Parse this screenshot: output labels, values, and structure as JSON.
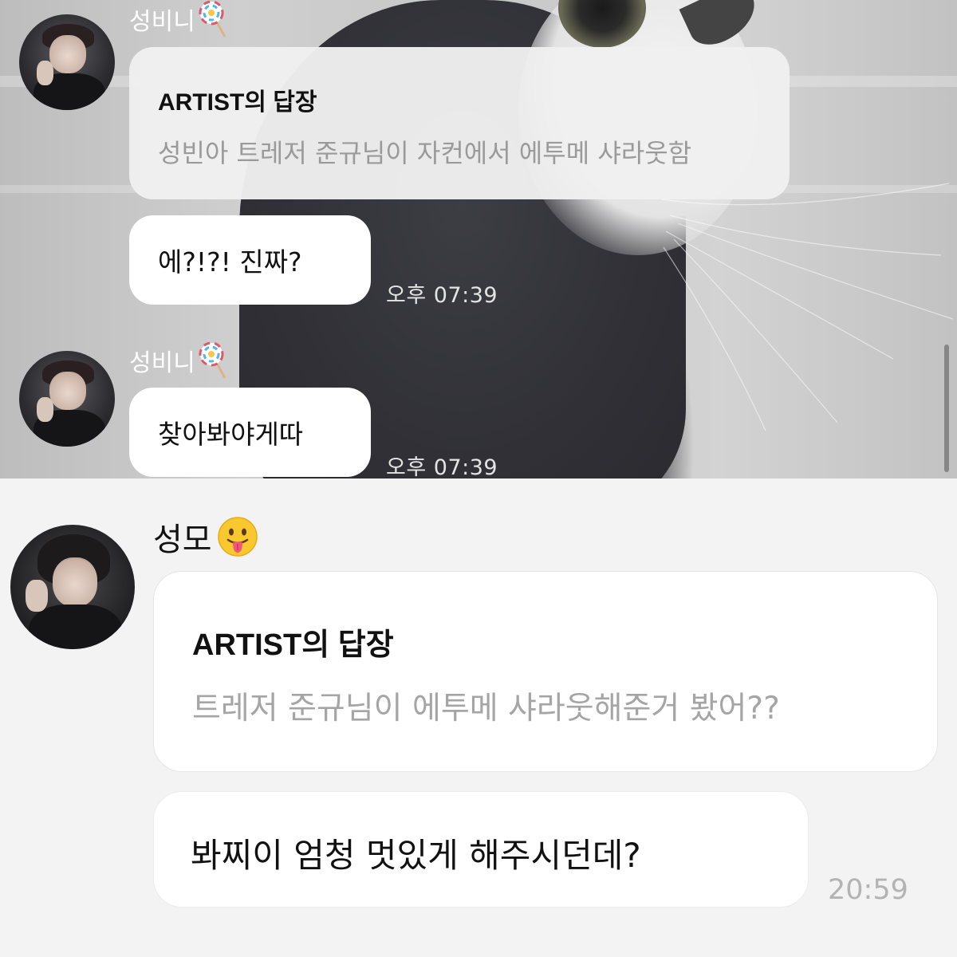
{
  "top_thread": {
    "messages": [
      {
        "sender": "성비니",
        "reply_title": "ARTIST의 답장",
        "reply_text": "성빈아 트레저 준규님이 자컨에서 에투메 샤라웃함",
        "text": "에?!?! 진짜?",
        "time": "오후 07:39"
      },
      {
        "sender": "성비니",
        "text": "찾아봐야게따",
        "time": "오후 07:39"
      }
    ]
  },
  "bottom_thread": {
    "sender": "성모",
    "reply_title": "ARTIST의 답장",
    "reply_text": "트레저 준규님이 에투메 샤라웃해준거 봤어??",
    "text": "봐찌이 엄청 멋있게 해주시던데?",
    "time": "20:59"
  },
  "icons": {
    "sender_emoji_top": "lollipop-icon",
    "sender_emoji_bottom": "tongue-out-face-icon"
  }
}
